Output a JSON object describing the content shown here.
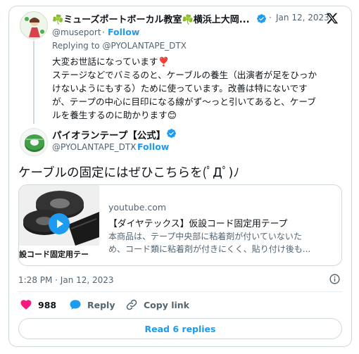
{
  "reply": {
    "display_name": "☘️ミューズポートボーカル教室☘️横浜上大岡...",
    "handle": "@museport",
    "follow_label": "Follow",
    "date": "Jan 12, 2023",
    "separator": "·",
    "replying_to_prefix": "Replying to",
    "replying_to_handle": "@PYOLANTAPE_DTX",
    "lines": [
      "大変お世話になっています❣️",
      "ステージなどでバミるのと、ケーブルの養生（出演者が足をひっか",
      "けないようにもする）ために使っています。改善は特にないです",
      "が、テープの中心に目印になる線がず〜っと引いてあると、ケーブ",
      "ルを養生するのに助かります😊"
    ]
  },
  "main": {
    "display_name": "パイオランテープ【公式】",
    "handle": "@PYOLANTAPE_DTX",
    "follow_label": "Follow",
    "separator": "·",
    "text": "ケーブルの固定にはぜひこちらを(ﾟДﾟ)ﾉ",
    "card": {
      "domain": "youtube.com",
      "title": "【ダイヤテックス】仮設コード固定用テープ",
      "desc_line1": "本商品は、テープ中央部に粘着剤が付いていないた",
      "desc_line2": "め、コード類に粘着剤が付きにくく、貼り付け後も...",
      "thumb_caption": "設コード固定用テー"
    },
    "timestamp": "1:28 PM · Jan 12, 2023",
    "likes": "988",
    "reply_label": "Reply",
    "copy_label": "Copy link",
    "read_replies": "Read 6 replies"
  },
  "colors": {
    "accent": "#1d9bf0",
    "like": "#f91880",
    "muted": "#536471",
    "border": "#cfd9de"
  },
  "icons": [
    "x-logo-icon",
    "verified-badge-icon",
    "heart-icon",
    "reply-bubble-icon",
    "link-icon",
    "info-icon",
    "play-icon"
  ]
}
